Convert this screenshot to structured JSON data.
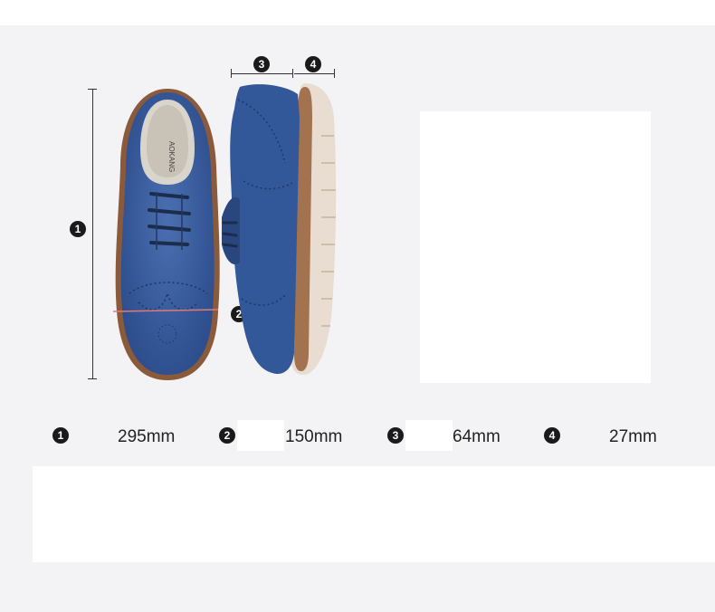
{
  "callouts": {
    "length": "1",
    "width": "2",
    "upper": "3",
    "sole": "4"
  },
  "shoe": {
    "upper_color": "#33589a",
    "sole_color": "#e8ddd0",
    "welt_color": "#8a5a3a",
    "insole_brand": "AOKANG"
  },
  "measurements": [
    {
      "badge": "1",
      "value": "295mm"
    },
    {
      "badge": "2",
      "value": "150mm"
    },
    {
      "badge": "3",
      "value": "64mm"
    },
    {
      "badge": "4",
      "value": "27mm"
    }
  ]
}
